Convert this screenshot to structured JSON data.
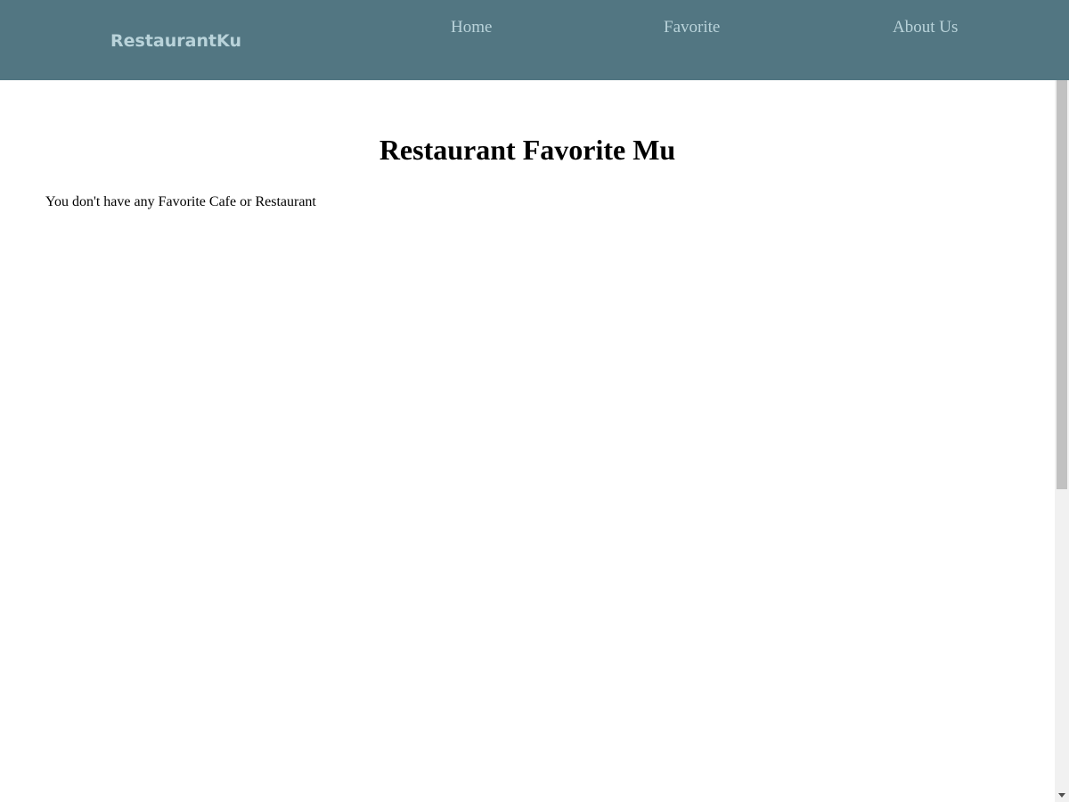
{
  "navbar": {
    "brand": "RestaurantKu",
    "links": [
      {
        "label": "Home"
      },
      {
        "label": "Favorite"
      },
      {
        "label": "About Us"
      }
    ]
  },
  "main": {
    "title": "Restaurant Favorite Mu",
    "empty_message": "You don't have any Favorite Cafe or Restaurant"
  },
  "colors": {
    "navbar_background": "#527682",
    "navbar_text": "#b9d3da",
    "page_background": "#ffffff",
    "text": "#000000"
  },
  "icons": {
    "scroll_down": "triangle-down-icon"
  }
}
